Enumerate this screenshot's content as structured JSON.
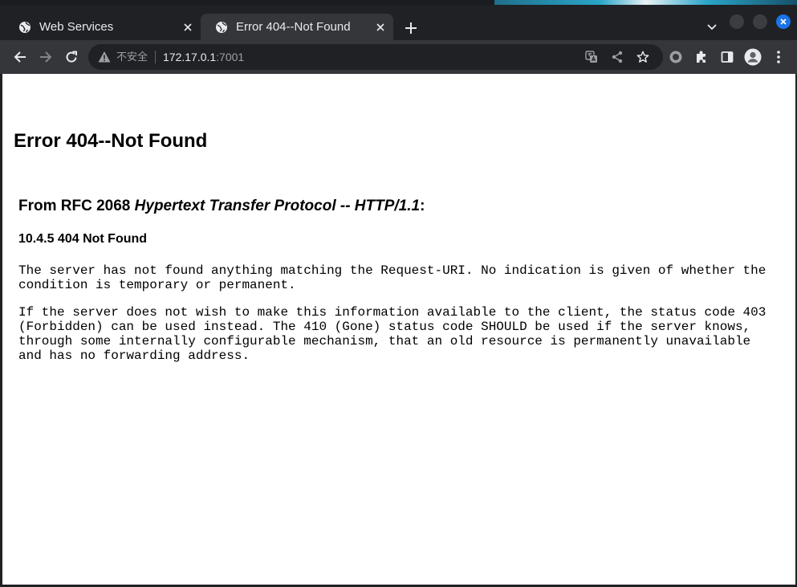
{
  "browser": {
    "tabs": [
      {
        "title": "Web Services",
        "active": false
      },
      {
        "title": "Error 404--Not Found",
        "active": true
      }
    ],
    "address": {
      "security_label": "不安全",
      "host": "172.17.0.1",
      "port": ":7001"
    },
    "colors": {
      "titlebar": "#202124",
      "toolbar": "#35363a",
      "accent": "#1a73e8"
    }
  },
  "page": {
    "heading": "Error 404--Not Found",
    "rfc_prefix": "From RFC 2068 ",
    "rfc_title": "Hypertext Transfer Protocol -- HTTP/1.1",
    "rfc_suffix": ":",
    "section": "10.4.5 404 Not Found",
    "paragraph1": "The server has not found anything matching the Request-URI. No indication is given of whether the condition is temporary or permanent.",
    "paragraph2": "If the server does not wish to make this information available to the client, the status code 403 (Forbidden) can be used instead. The 410 (Gone) status code SHOULD be used if the server knows, through some internally configurable mechanism, that an old resource is permanently unavailable and has no forwarding address."
  }
}
